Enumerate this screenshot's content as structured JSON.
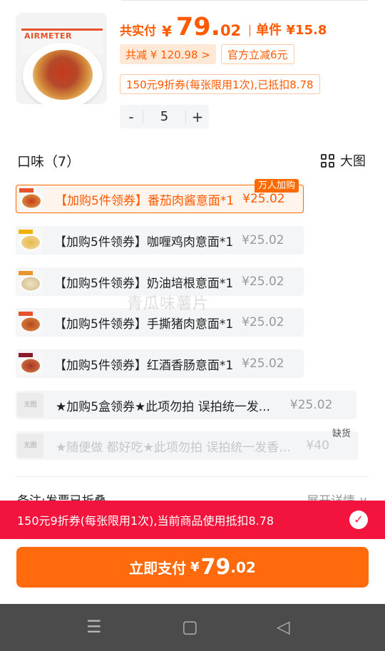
{
  "product": {
    "brand": "AIRMETER",
    "total_label": "共实付",
    "currency": "¥",
    "total_int": "79.",
    "total_dec": "02",
    "unit_label": "单件 ¥15.8",
    "save_chip": "共减 ¥ 120.98 >",
    "official_chip": "官方立减6元",
    "coupon_chip": "150元9折券(每张限用1次),已抵扣8.78",
    "qty_minus": "-",
    "qty": "5",
    "qty_plus": "+"
  },
  "flavor": {
    "title": "口味（7）",
    "big_view": "大图",
    "badge": "万人加购",
    "out_of_stock": "缺货",
    "no_image": "无图",
    "options": [
      {
        "name": "【加购5件领券】番茄肉酱意面*1",
        "price": "¥25.02"
      },
      {
        "name": "【加购5件领券】咖喱鸡肉意面*1",
        "price": "¥25.02"
      },
      {
        "name": "【加购5件领券】奶油培根意面*1",
        "price": "¥25.02"
      },
      {
        "name": "【加购5件领券】手撕猪肉意面*1",
        "price": "¥25.02"
      },
      {
        "name": "【加购5件领券】红酒香肠意面*1",
        "price": "¥25.02"
      },
      {
        "name": "★加购5盒领券★此项勿拍 误拍统一发...",
        "price": "¥25.02"
      },
      {
        "name": "★随便做 都好吃★此项勿拍 误拍统一发香...",
        "price": "¥40"
      }
    ]
  },
  "watermark": "青瓜味薯片",
  "note": {
    "left": "备注:发票已折叠",
    "right": "展开详情 ∨"
  },
  "banner": {
    "text": "150元9折券(每张限用1次),当前商品使用抵扣8.78",
    "check": "✓"
  },
  "pay_button": {
    "label": "立即支付",
    "currency": "¥",
    "int": "79",
    "dec": ".02"
  },
  "navbar": {
    "menu": "☰",
    "home": "▢",
    "back": "◁"
  },
  "colors": {
    "accent": "#ff6a0d",
    "banner": "#f2143c"
  }
}
